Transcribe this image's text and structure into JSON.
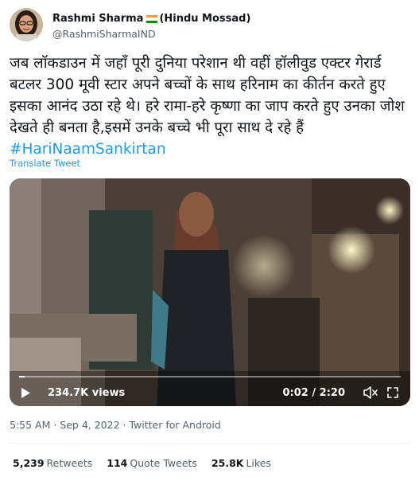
{
  "author": {
    "display_name": "Rashmi Sharma",
    "name_suffix": "(Hindu Mossad)",
    "handle": "@RashmiSharmaIND",
    "flag_icon": "india-flag-icon"
  },
  "tweet": {
    "text": "जब लॉकडाउन में जहाँ पूरी दुनिया परेशान थी वहीं हॉलीवुड एक्टर गेरार्ड बटलर 300 मूवी स्टार अपने बच्चों के साथ हरिनाम का कीर्तन करते हुए इसका आनंद उठा रहे थे। हरे रामा-हरे कृष्णा का जाप करते हुए उनका जोश देखते ही बनता है,इसमें उनके बच्चे भी पूरा साथ दे रहे हैं ",
    "hashtag": "#HariNaamSankirtan",
    "translate_label": "Translate Tweet"
  },
  "video": {
    "views": "234.7K views",
    "time": "0:02 / 2:20",
    "progress": 0.015
  },
  "meta": {
    "timestamp": "5:55 AM · Sep 4, 2022 · Twitter for Android"
  },
  "stats": {
    "retweets_count": "5,239",
    "retweets_label": "Retweets",
    "quotes_count": "114",
    "quotes_label": "Quote Tweets",
    "likes_count": "25.8K",
    "likes_label": "Likes"
  },
  "colors": {
    "link": "#1d9bf0",
    "secondary_text": "#536471",
    "primary_text": "#0f1419"
  }
}
